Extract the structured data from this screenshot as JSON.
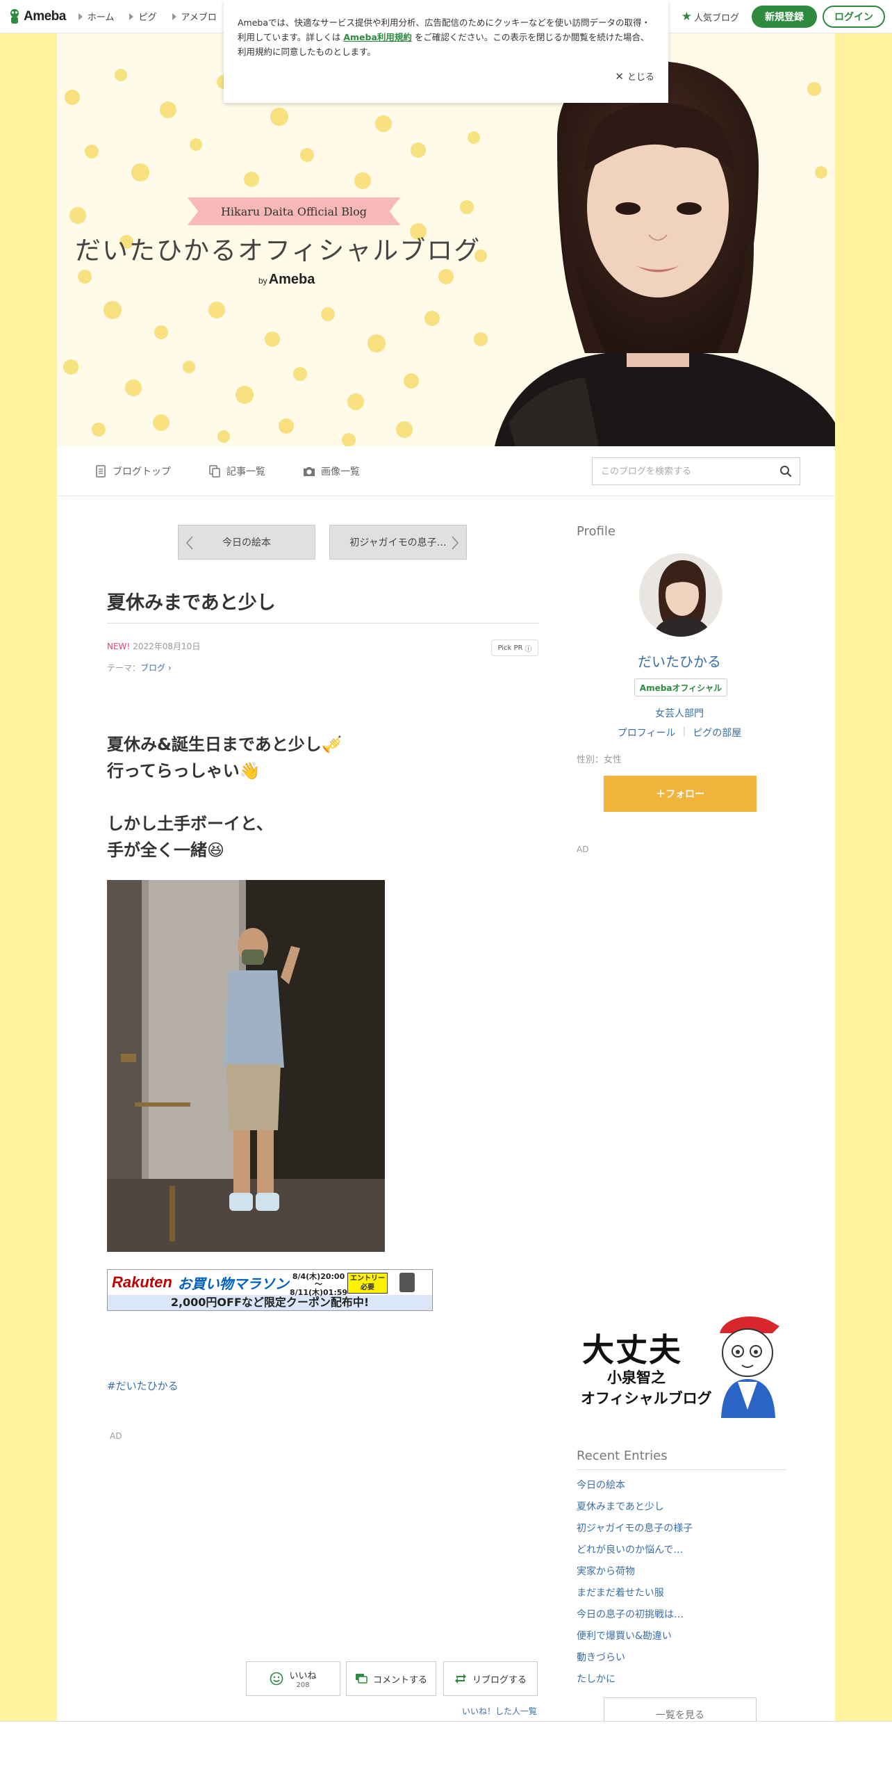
{
  "topbar": {
    "logo": "Ameba",
    "nav": [
      "ホーム",
      "ピグ",
      "アメブロ"
    ],
    "popular_blog": "人気ブログ",
    "register": "新規登録",
    "login": "ログイン"
  },
  "cookie": {
    "text_before": "Amebaでは、快適なサービス提供や利用分析、広告配信のためにクッキーなどを使い訪問データの取得・利用しています。詳しくは ",
    "link": "Ameba利用規約",
    "text_after": " をご確認ください。この表示を閉じるか閲覧を続けた場合、利用規約に同意したものとします。",
    "close": "とじる"
  },
  "header": {
    "badge": "Hikaru Daita Official Blog",
    "title": "だいたひかるオフィシャルブログ",
    "by": "by",
    "ameba": "Ameba"
  },
  "blognav": {
    "items": [
      "ブログトップ",
      "記事一覧",
      "画像一覧"
    ],
    "search_placeholder": "このブログを検索する"
  },
  "pager": {
    "prev": "今日の絵本",
    "next": "初ジャガイモの息子…"
  },
  "article": {
    "title": "夏休みまであと少し",
    "new_label": "NEW!",
    "date": "2022年08月10日",
    "pick_pr": "Pick PR",
    "theme_label": "テーマ：",
    "theme": "ブログ",
    "body": "夏休み&誕生日まであと少し🎺\n行ってらっしゃい👋\n\nしかし土手ボーイと、\n手が全く一緒😆",
    "hashtag": "#だいたひかる",
    "ad": "AD"
  },
  "rakuten": {
    "logo": "Rakuten",
    "name": "お買い物マラソン",
    "date1": "8/4(木)20:00",
    "tilde": "〜",
    "date2": "8/11(木)01:59",
    "entry": "エントリー必要",
    "coupon": "2,000円OFFなど限定クーポン配布中!"
  },
  "actions": {
    "like": "いいね",
    "like_count": "208",
    "comment": "コメントする",
    "reblog": "リブログする",
    "liked_list": "いいね！した人一覧"
  },
  "sidebar": {
    "profile_head": "Profile",
    "name": "だいたひかる",
    "official": "Amebaオフィシャル",
    "category": "女芸人部門",
    "links": [
      "プロフィール",
      "ピグの部屋"
    ],
    "gender": "性別：女性",
    "follow": "＋フォロー",
    "ad": "AD",
    "banner": {
      "line1": "大丈夫",
      "line2": "小泉智之",
      "line3": "オフィシャルブログ"
    },
    "recent_head": "Recent Entries",
    "recent": [
      "今日の絵本",
      "夏休みまであと少し",
      "初ジャガイモの息子の様子",
      "どれが良いのか悩んで…",
      "実家から荷物",
      "まだまだ着せたい服",
      "今日の息子の初挑戦は…",
      "便利で爆買い&勘違い",
      "動きづらい",
      "たしかに"
    ],
    "see_all": "一覧を見る"
  },
  "colors": {
    "ameba_green": "#2d8a3e",
    "page_yellow": "#fff3a0",
    "follow_orange": "#f0b43c",
    "link_blue": "#3a6ea5"
  }
}
